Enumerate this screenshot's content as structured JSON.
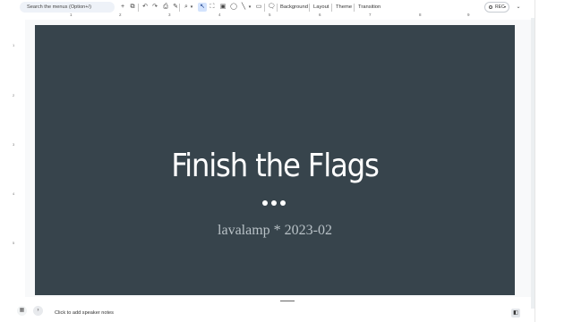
{
  "toolbar": {
    "search_placeholder": "Search the menus (Option+/)",
    "icons": [
      "plus-icon",
      "new-slide-icon",
      "undo-icon",
      "redo-icon",
      "print-icon",
      "paint-format-icon",
      "zoom-icon",
      "select-icon",
      "fit-icon",
      "image-icon",
      "shapes-icon",
      "line-icon",
      "video-icon",
      "comment-icon"
    ],
    "background_label": "Background",
    "layout_label": "Layout",
    "theme_label": "Theme",
    "transition_label": "Transition",
    "rec_label": "REC"
  },
  "ruler": {
    "marks": [
      "1",
      "2",
      "3",
      "4",
      "5",
      "6",
      "7",
      "8",
      "9"
    ]
  },
  "slide": {
    "title": "Finish the Flags",
    "subtitle": "lavalamp * 2023-02",
    "background_color": "#37444c"
  },
  "notes": {
    "placeholder": "Click to add speaker notes"
  }
}
